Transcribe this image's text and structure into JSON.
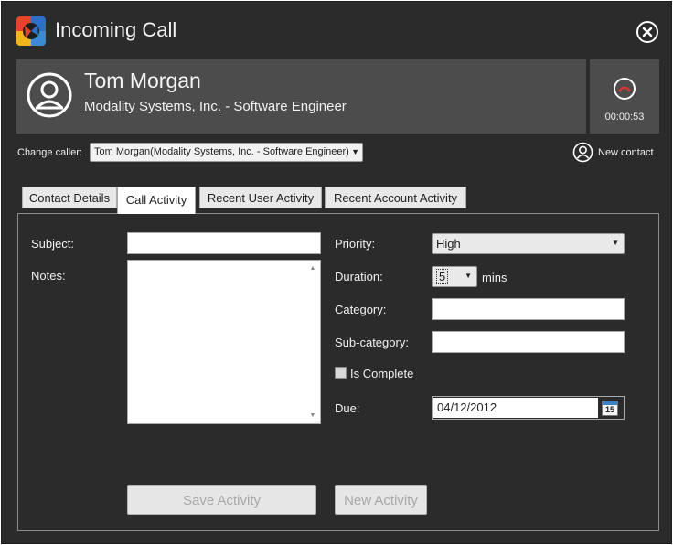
{
  "window": {
    "title": "Incoming Call"
  },
  "caller": {
    "name": "Tom Morgan",
    "company": "Modality Systems, Inc.",
    "role_separator": " - ",
    "role": "Software Engineer"
  },
  "call": {
    "duration": "00:00:53"
  },
  "change_caller": {
    "label": "Change caller:",
    "selected": "Tom Morgan(Modality Systems, Inc. - Software Engineer)"
  },
  "new_contact": {
    "label": "New contact"
  },
  "tabs": [
    {
      "label": "Contact Details"
    },
    {
      "label": "Call Activity"
    },
    {
      "label": "Recent User Activity"
    },
    {
      "label": "Recent Account Activity"
    }
  ],
  "form": {
    "subject_label": "Subject:",
    "subject_value": "",
    "notes_label": "Notes:",
    "notes_value": "",
    "priority_label": "Priority:",
    "priority_value": "High",
    "duration_label": "Duration:",
    "duration_value": "5",
    "duration_unit": "mins",
    "category_label": "Category:",
    "category_value": "",
    "subcategory_label": "Sub-category:",
    "subcategory_value": "",
    "is_complete_label": "Is Complete",
    "due_label": "Due:",
    "due_value": "04/12/2012",
    "calendar_day": "15"
  },
  "buttons": {
    "save_label": "Save Activity",
    "new_label": "New Activity"
  },
  "colors": {
    "background": "#2b2b2b",
    "card": "#4c4c4c",
    "hangup_red": "#e03030",
    "disabled_text": "#a8a8a8"
  }
}
